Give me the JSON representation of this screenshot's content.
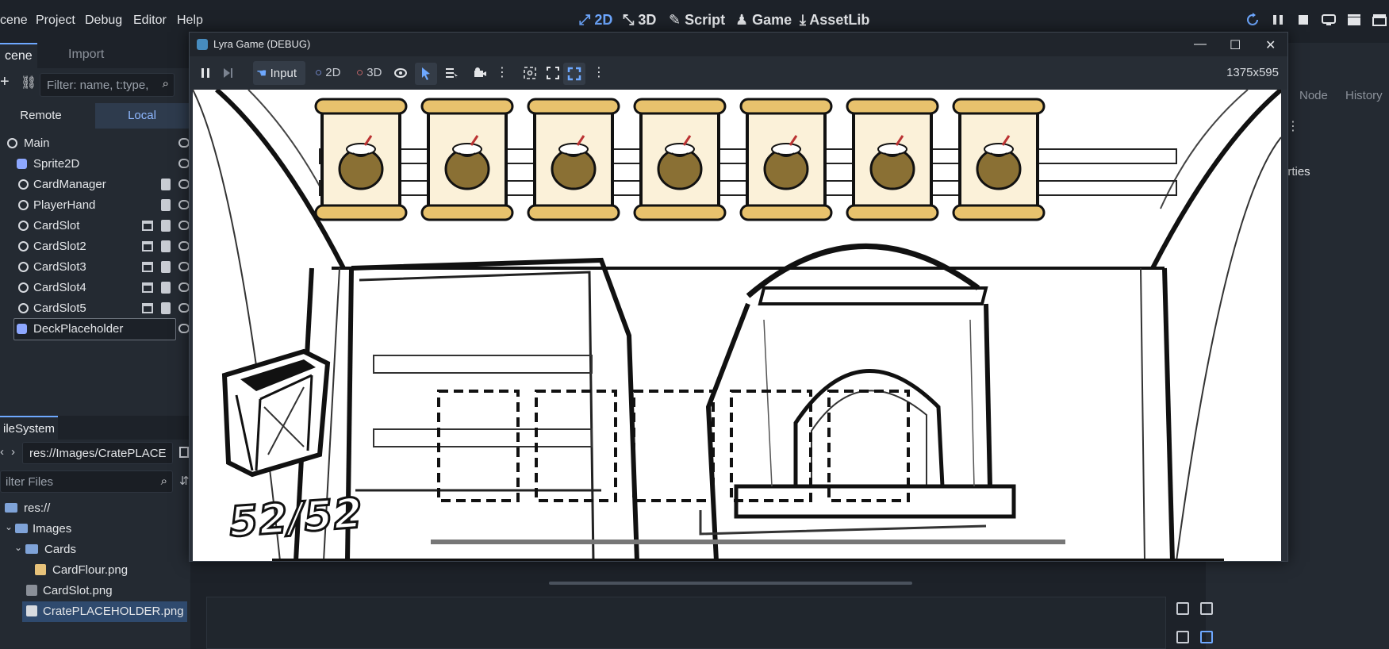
{
  "menubar": {
    "items": [
      "cene",
      "Project",
      "Debug",
      "Editor",
      "Help"
    ],
    "workspaces": [
      {
        "label": "2D",
        "active": true
      },
      {
        "label": "3D",
        "active": false
      },
      {
        "label": "Script",
        "active": false
      },
      {
        "label": "Game",
        "active": false
      },
      {
        "label": "AssetLib",
        "active": false
      }
    ]
  },
  "scene_dock": {
    "tabs": [
      "cene",
      "Import"
    ],
    "filter_placeholder": "Filter: name, t:type,",
    "remote_label": "Remote",
    "local_label": "Local",
    "nodes": [
      {
        "label": "Main",
        "icon": "node-icon"
      },
      {
        "label": "Sprite2D",
        "icon": "sprite-icon"
      },
      {
        "label": "CardManager",
        "icon": "node-icon"
      },
      {
        "label": "PlayerHand",
        "icon": "node-icon"
      },
      {
        "label": "CardSlot",
        "icon": "node-icon"
      },
      {
        "label": "CardSlot2",
        "icon": "node-icon"
      },
      {
        "label": "CardSlot3",
        "icon": "node-icon"
      },
      {
        "label": "CardSlot4",
        "icon": "node-icon"
      },
      {
        "label": "CardSlot5",
        "icon": "node-icon"
      },
      {
        "label": "DeckPlaceholder",
        "icon": "sprite-icon"
      }
    ]
  },
  "filesystem": {
    "tab_label": "ileSystem",
    "path": "res://Images/CratePLACE",
    "filter_placeholder": "ilter Files",
    "items": [
      {
        "label": "res://",
        "type": "folder"
      },
      {
        "label": "Images",
        "type": "folder"
      },
      {
        "label": "Cards",
        "type": "folder"
      },
      {
        "label": "CardFlour.png",
        "type": "image"
      },
      {
        "label": "CardSlot.png",
        "type": "image"
      },
      {
        "label": "CratePLACEHOLDER.png",
        "type": "image"
      }
    ]
  },
  "right_panel": {
    "tabs": [
      "Node",
      "History"
    ],
    "properties_label": "erties"
  },
  "game_window": {
    "title": "Lyra Game (DEBUG)",
    "toolbar": {
      "input_label": "Input",
      "mode_2d": "2D",
      "mode_3d": "3D"
    },
    "resolution": "1375x595",
    "deck_count": "52/52",
    "card_count": 7,
    "slot_count": 5
  },
  "colors": {
    "accent": "#6ea8ff",
    "editor_bg": "#1d2229",
    "panel_bg": "#242a32",
    "selection": "#2f4a6e",
    "card_fill": "#fbf1d9",
    "scroll_gold": "#e8c26d",
    "sack_brown": "#8a7034"
  }
}
